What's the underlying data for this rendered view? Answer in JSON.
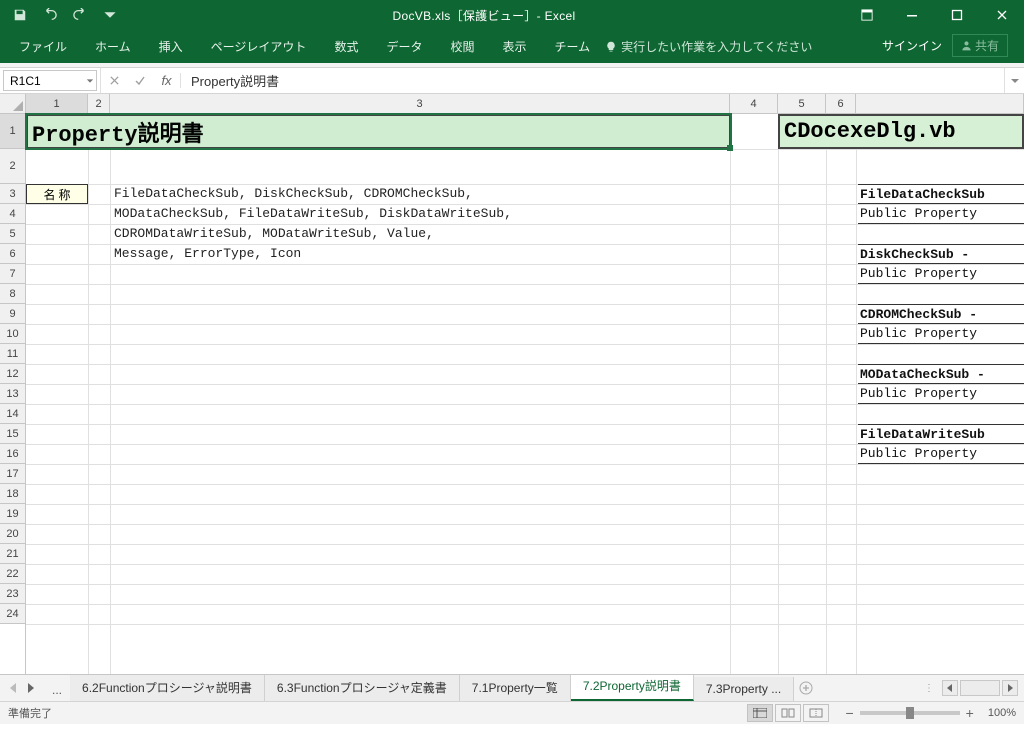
{
  "titlebar": {
    "title": "DocVB.xls［保護ビュー］- Excel"
  },
  "ribbon": {
    "tabs": [
      "ファイル",
      "ホーム",
      "挿入",
      "ページレイアウト",
      "数式",
      "データ",
      "校閲",
      "表示",
      "チーム"
    ],
    "tell_me": "実行したい作業を入力してください",
    "signin": "サインイン",
    "share": "共有"
  },
  "namebox": {
    "value": "R1C1"
  },
  "formula": {
    "value": "Property説明書"
  },
  "columns": {
    "c1": "1",
    "c2": "2",
    "c3": "3",
    "c4": "4",
    "c5": "5",
    "c6": "6"
  },
  "rows": [
    "1",
    "2",
    "3",
    "4",
    "5",
    "6",
    "7",
    "8",
    "9",
    "10",
    "11",
    "12",
    "13",
    "14",
    "15",
    "16",
    "17",
    "18",
    "19",
    "20",
    "21",
    "22",
    "23",
    "24"
  ],
  "sheet": {
    "title_main": "Property説明書",
    "title_side": "CDocexeDlg.vb",
    "label_name": "名 称",
    "lines": {
      "l3": "FileDataCheckSub, DiskCheckSub, CDROMCheckSub,",
      "l4": "MODataCheckSub, FileDataWriteSub, DiskDataWriteSub,",
      "l5": "CDROMDataWriteSub, MODataWriteSub, Value,",
      "l6": "Message, ErrorType, Icon"
    },
    "right": {
      "r3": "FileDataCheckSub",
      "r4": "Public Property",
      "r6": "DiskCheckSub -",
      "r7": "Public Property",
      "r9": "CDROMCheckSub -",
      "r10": "Public Property",
      "r12": "MODataCheckSub -",
      "r13": "Public Property",
      "r15": "FileDataWriteSub",
      "r16": "Public Property"
    }
  },
  "sheet_tabs": {
    "dots": "...",
    "t1": "6.2Functionプロシージャ説明書",
    "t2": "6.3Functionプロシージャ定義書",
    "t3": "7.1Property一覧",
    "t4": "7.2Property説明書",
    "t5": "7.3Property ..."
  },
  "statusbar": {
    "ready": "準備完了",
    "zoom": "100%"
  },
  "chart_data": {
    "type": "table",
    "title": "Property説明書",
    "categories": [
      "名 称"
    ],
    "values": [
      "FileDataCheckSub, DiskCheckSub, CDROMCheckSub, MODataCheckSub, FileDataWriteSub, DiskDataWriteSub, CDROMDataWriteSub, MODataWriteSub, Value, Message, ErrorType, Icon"
    ]
  }
}
